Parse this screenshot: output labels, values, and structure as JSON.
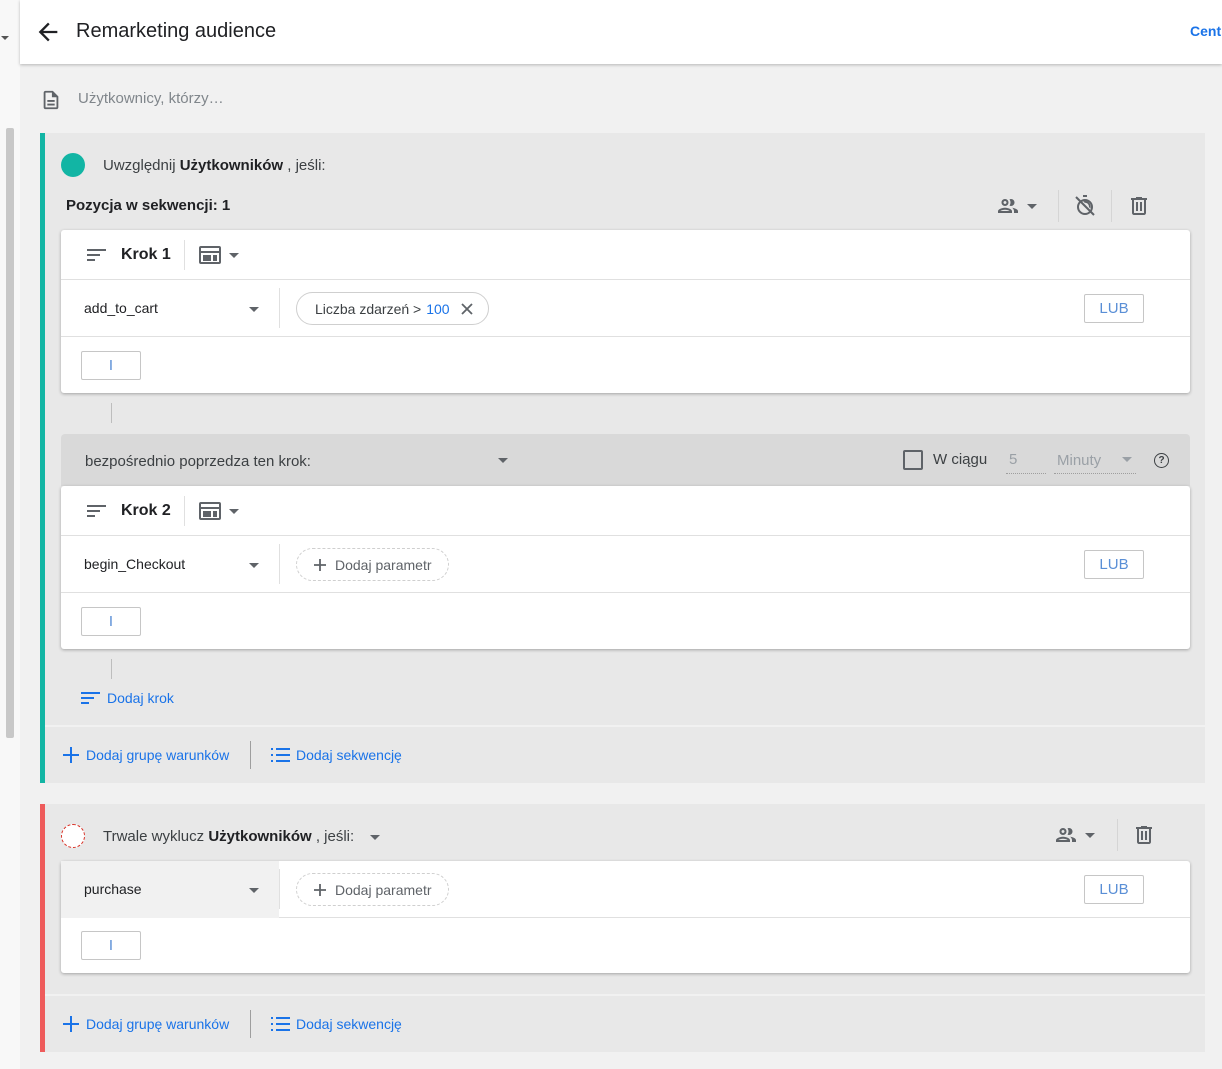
{
  "header": {
    "title": "Remarketing audience",
    "right_link": "Centrum"
  },
  "description": {
    "placeholder": "Użytkownicy, którzy…"
  },
  "include_group": {
    "prefix": "Uwzględnij",
    "subject": "Użytkowników",
    "suffix": ", jeśli:",
    "sequence_title": "Pozycja w sekwencji: 1",
    "steps": [
      {
        "label": "Krok 1",
        "event": "add_to_cart",
        "chip_label": "Liczba zdarzeń >",
        "chip_value": "100",
        "or_label": "LUB",
        "and_label": "I"
      },
      {
        "label": "Krok 2",
        "event": "begin_Checkout",
        "add_param_label": "Dodaj parametr",
        "or_label": "LUB",
        "and_label": "I"
      }
    ],
    "sequence_condition": {
      "text": "bezpośrednio poprzedza ten krok:",
      "within_label": "W ciągu",
      "within_value": "5",
      "within_unit": "Minuty",
      "help": "?"
    },
    "add_step_label": "Dodaj krok",
    "add_group_label": "Dodaj grupę warunków",
    "add_sequence_label": "Dodaj sekwencję"
  },
  "exclude_group": {
    "prefix": "Trwale wyklucz",
    "subject": "Użytkowników",
    "suffix": ", jeśli:",
    "event": "purchase",
    "add_param_label": "Dodaj parametr",
    "or_label": "LUB",
    "and_label": "I",
    "add_group_label": "Dodaj grupę warunków",
    "add_sequence_label": "Dodaj sekwencję"
  },
  "colors": {
    "include_accent": "#12b5a4",
    "exclude_accent": "#ee5b5b",
    "link": "#1a73e8"
  }
}
